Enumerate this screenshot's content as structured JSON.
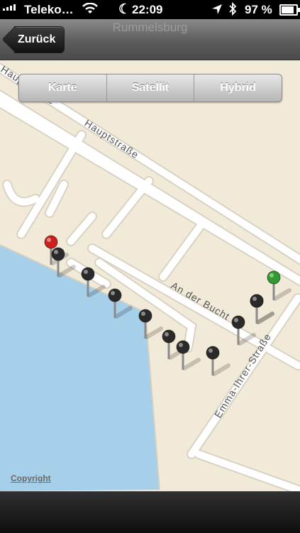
{
  "status_bar": {
    "carrier": "Teleko…",
    "time": "22:09",
    "battery_percent_label": "97 %",
    "battery_level": 0.97,
    "icons": [
      "signal-icon",
      "wifi-icon",
      "moon-icon",
      "location-arrow-icon",
      "bluetooth-icon",
      "battery-icon"
    ]
  },
  "nav": {
    "title": "Rummelsburg",
    "back_label": "Zurück"
  },
  "map_type": {
    "options": [
      "Karte",
      "Satellit",
      "Hybrid"
    ]
  },
  "map": {
    "streets": [
      "Hauptstraße",
      "Hauptstraße",
      "An der Bucht",
      "Emma-Ihrer-Straße"
    ],
    "pins": [
      {
        "color": "red"
      },
      {
        "color": "black"
      },
      {
        "color": "black"
      },
      {
        "color": "black"
      },
      {
        "color": "black"
      },
      {
        "color": "black"
      },
      {
        "color": "black"
      },
      {
        "color": "black"
      },
      {
        "color": "black"
      },
      {
        "color": "black"
      },
      {
        "color": "black"
      },
      {
        "color": "green"
      }
    ],
    "colors": {
      "land": "#f2ead8",
      "water": "#a6cfe9",
      "road": "#ffffff",
      "pin_red": "#cc1f1f",
      "pin_black": "#2a2a2a",
      "pin_green": "#2f9a2f"
    }
  },
  "copyright_label": "Copyright"
}
